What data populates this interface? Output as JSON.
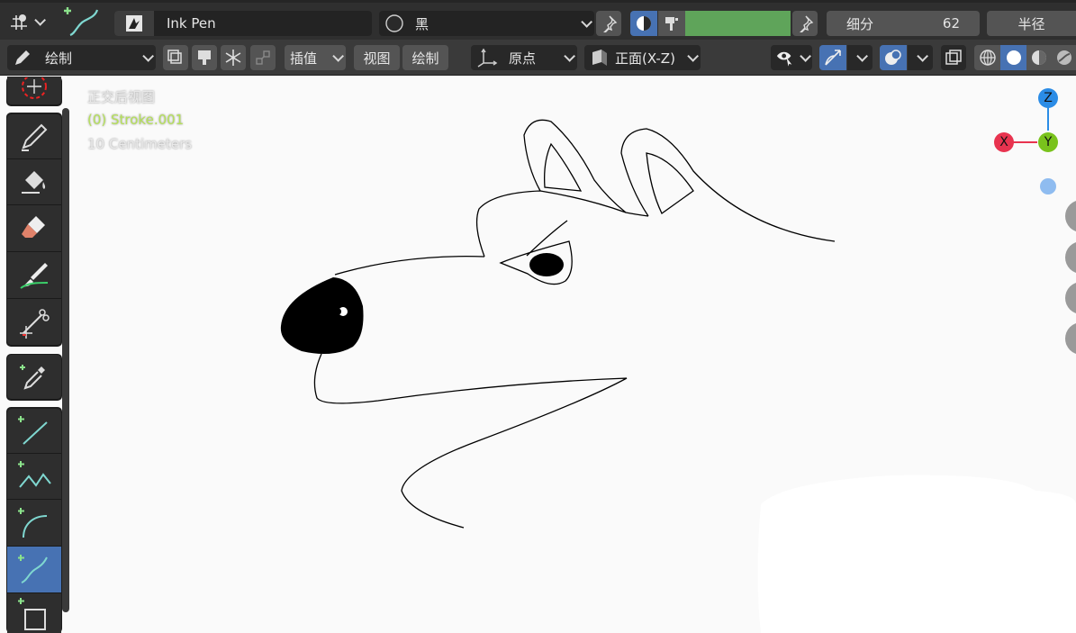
{
  "header": {
    "brush_name": "Ink Pen",
    "material_name": "黑",
    "subdivision_label": "细分",
    "subdivision_value": "62",
    "radius_label": "半径",
    "color_swatch": "#5fa45a"
  },
  "toolbar": {
    "mode_label": "绘制",
    "interpolate_label": "插值",
    "view_label": "视图",
    "draw_label": "绘制",
    "origin_label": "原点",
    "orientation_label": "正面(X-Z)"
  },
  "viewport": {
    "view_name": "正交后视图",
    "active_object": "(0) Stroke.001",
    "scale_text": "10 Centimeters",
    "background": "#fafafa"
  },
  "gizmo": {
    "z_label": "Z",
    "x_label": "X",
    "y_label": "Y",
    "z_color": "#2b8ce6",
    "x_color": "#e8334f",
    "y_color": "#79c21c"
  },
  "tools": [
    "cursor-tool",
    "draw-tool",
    "fill-tool",
    "erase-tool",
    "tint-tool",
    "cutter-tool",
    "eyedropper-tool",
    "line-tool",
    "polyline-tool",
    "arc-tool",
    "curve-tool",
    "box-tool"
  ]
}
